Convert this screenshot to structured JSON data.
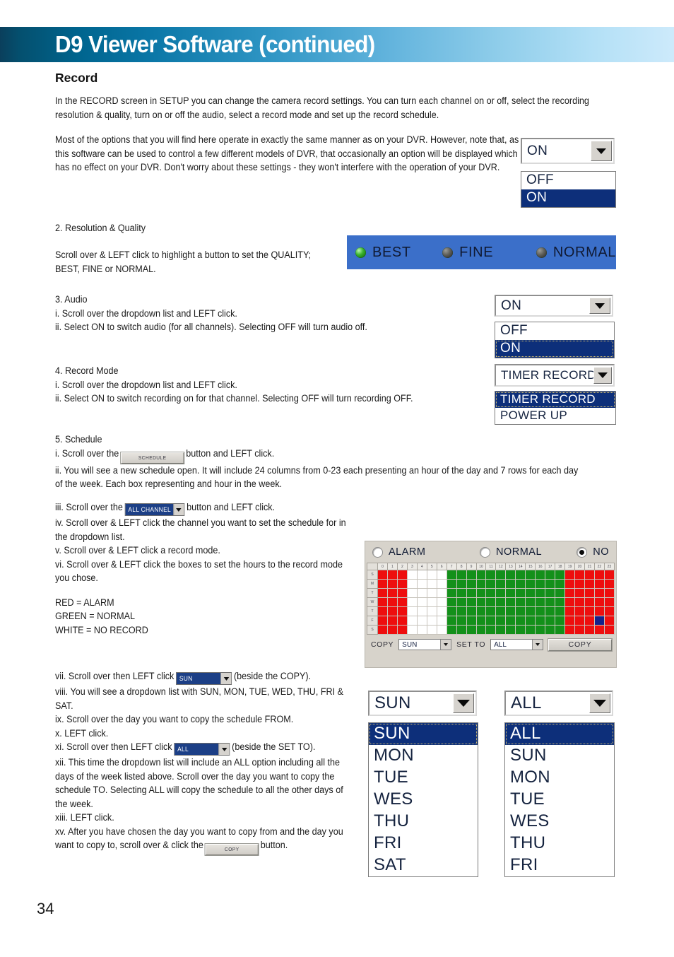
{
  "header": {
    "title": "D9 Viewer Software (continued)"
  },
  "section": {
    "heading": "Record",
    "intro_1": "In the RECORD screen in SETUP you can change the camera record settings. You can turn each channel on or off, select the recording resolution & quality, turn on or off the audio, select a record mode and set up the record schedule.",
    "intro_2": "Most of the options that you will find here operate in exactly the same manner as on your DVR. However, note that, as this software can be used to control a few different models of DVR, that occasionally an option will be displayed which has no effect on your DVR. Don't worry about these settings - they won't interfere with the operation of your DVR."
  },
  "step2": {
    "title": "2. Resolution & Quality",
    "body": "Scroll over & LEFT click to highlight a button to set the  QUALITY; BEST, FINE or NORMAL."
  },
  "step3": {
    "title": "3. Audio",
    "line_i": "i. Scroll over the dropdown list and LEFT click.",
    "line_ii": "ii. Select ON to switch audio (for all channels). Selecting OFF will turn audio off."
  },
  "step4": {
    "title": "4. Record Mode",
    "line_i": "i. Scroll over the dropdown list and LEFT click.",
    "line_ii": "ii. Select ON to switch recording on for that channel. Selecting OFF will turn recording OFF."
  },
  "step5": {
    "title": "5. Schedule",
    "line_i_a": "i. Scroll over the",
    "line_i_btn": "SCHEDULE",
    "line_i_b": "button and LEFT click.",
    "line_ii": "ii. You will see a new schedule open. It will include 24 columns from 0-23 each presenting an hour of the day and 7 rows for each day of the week. Each box representing and hour in the week.",
    "line_iii_a": "iii. Scroll over the",
    "line_iii_btn": "ALL CHANNEL",
    "line_iii_b": "button and LEFT click.",
    "line_iv": "iv. Scroll over & LEFT click the channel you want to set the schedule for in the dropdown list.",
    "line_v": "v. Scroll over & LEFT click a record mode.",
    "line_vi": "vi. Scroll over & LEFT click the boxes to set the hours to the record mode you chose.",
    "legend_red": "RED = ALARM",
    "legend_green": "GREEN = NORMAL",
    "legend_white": "WHITE = NO RECORD",
    "line_vii_a": "vii. Scroll over then LEFT click",
    "line_vii_btn": "SUN",
    "line_vii_b": "(beside the COPY).",
    "line_viii": "viii. You will see a dropdown list with SUN, MON, TUE, WED, THU, FRI & SAT.",
    "line_ix": "ix. Scroll over the day you want to copy the schedule FROM.",
    "line_x": "x. LEFT click.",
    "line_xi_a": "xi. Scroll over then LEFT click",
    "line_xi_btn": "ALL",
    "line_xi_b": "(beside the SET TO).",
    "line_xii": "xii. This time the dropdown list will include an ALL option including all the days of the week listed above. Scroll over the day you want to copy the schedule TO. Selecting ALL will copy the schedule to all the other days of the week.",
    "line_xiii": "xiii. LEFT click.",
    "line_xv_a": "xv. After you have chosen the day you want to copy from and the day you want to copy to, scroll over & click the",
    "line_xv_btn": "COPY",
    "line_xv_b": "button."
  },
  "widgets": {
    "channel_combo": {
      "value": "ON",
      "options": [
        "OFF",
        "ON"
      ],
      "selected_index": 1
    },
    "quality_bar": {
      "items": [
        {
          "label": "BEST",
          "on": true
        },
        {
          "label": "FINE",
          "on": false
        },
        {
          "label": "NORMAL",
          "on": false
        }
      ],
      "background_color": "#3b6fc9",
      "led_on_color": "#39b32c"
    },
    "audio_combo": {
      "value": "ON",
      "options": [
        "OFF",
        "ON"
      ],
      "selected_index": 1
    },
    "recmode_combo": {
      "value": "TIMER RECORD",
      "options": [
        "TIMER RECORD",
        "POWER UP"
      ],
      "selected_index": 0
    },
    "copy_from_combo": {
      "value": "SUN",
      "options": [
        "SUN",
        "MON",
        "TUE",
        "WES",
        "THU",
        "FRI",
        "SAT"
      ],
      "selected_index": 0
    },
    "set_to_combo": {
      "value": "ALL",
      "options": [
        "ALL",
        "SUN",
        "MON",
        "TUE",
        "WES",
        "THU",
        "FRI"
      ],
      "selected_index": 0
    }
  },
  "schedule_window": {
    "modes": [
      {
        "label": "ALARM",
        "selected": false
      },
      {
        "label": "NORMAL",
        "selected": false
      },
      {
        "label": "NO",
        "selected": true
      }
    ],
    "hour_headers": [
      "0",
      "1",
      "2",
      "3",
      "4",
      "5",
      "6",
      "7",
      "8",
      "9",
      "10",
      "11",
      "12",
      "13",
      "14",
      "15",
      "16",
      "17",
      "18",
      "19",
      "20",
      "21",
      "22",
      "23"
    ],
    "day_rows": [
      "S",
      "M",
      "T",
      "W",
      "T",
      "F",
      "S"
    ],
    "cells": [
      [
        "r",
        "r",
        "r",
        "w",
        "w",
        "w",
        "w",
        "g",
        "g",
        "g",
        "g",
        "g",
        "g",
        "g",
        "g",
        "g",
        "g",
        "g",
        "g",
        "r",
        "r",
        "r",
        "r",
        "r"
      ],
      [
        "r",
        "r",
        "r",
        "w",
        "w",
        "w",
        "w",
        "g",
        "g",
        "g",
        "g",
        "g",
        "g",
        "g",
        "g",
        "g",
        "g",
        "g",
        "g",
        "r",
        "r",
        "r",
        "r",
        "r"
      ],
      [
        "r",
        "r",
        "r",
        "w",
        "w",
        "w",
        "w",
        "g",
        "g",
        "g",
        "g",
        "g",
        "g",
        "g",
        "g",
        "g",
        "g",
        "g",
        "g",
        "r",
        "r",
        "r",
        "r",
        "r"
      ],
      [
        "r",
        "r",
        "r",
        "w",
        "w",
        "w",
        "w",
        "g",
        "g",
        "g",
        "g",
        "g",
        "g",
        "g",
        "g",
        "g",
        "g",
        "g",
        "g",
        "r",
        "r",
        "r",
        "r",
        "r"
      ],
      [
        "r",
        "r",
        "r",
        "w",
        "w",
        "w",
        "w",
        "g",
        "g",
        "g",
        "g",
        "g",
        "g",
        "g",
        "g",
        "g",
        "g",
        "g",
        "g",
        "r",
        "r",
        "r",
        "r",
        "r"
      ],
      [
        "r",
        "r",
        "r",
        "w",
        "w",
        "w",
        "w",
        "g",
        "g",
        "g",
        "g",
        "g",
        "g",
        "g",
        "g",
        "g",
        "g",
        "g",
        "g",
        "r",
        "r",
        "r",
        "b",
        "r"
      ],
      [
        "r",
        "r",
        "r",
        "w",
        "w",
        "w",
        "w",
        "g",
        "g",
        "g",
        "g",
        "g",
        "g",
        "g",
        "g",
        "g",
        "g",
        "g",
        "g",
        "r",
        "r",
        "r",
        "r",
        "r"
      ]
    ],
    "legend_colors": {
      "alarm": "#ee0e0e",
      "normal": "#13901a",
      "no_record": "#ffffff",
      "cursor": "#13228c"
    },
    "bottom_bar": {
      "copy_label": "COPY",
      "copy_value": "SUN",
      "set_to_label": "SET TO",
      "set_to_value": "ALL",
      "copy_button": "COPY"
    }
  },
  "footer": {
    "page_number": "34"
  }
}
